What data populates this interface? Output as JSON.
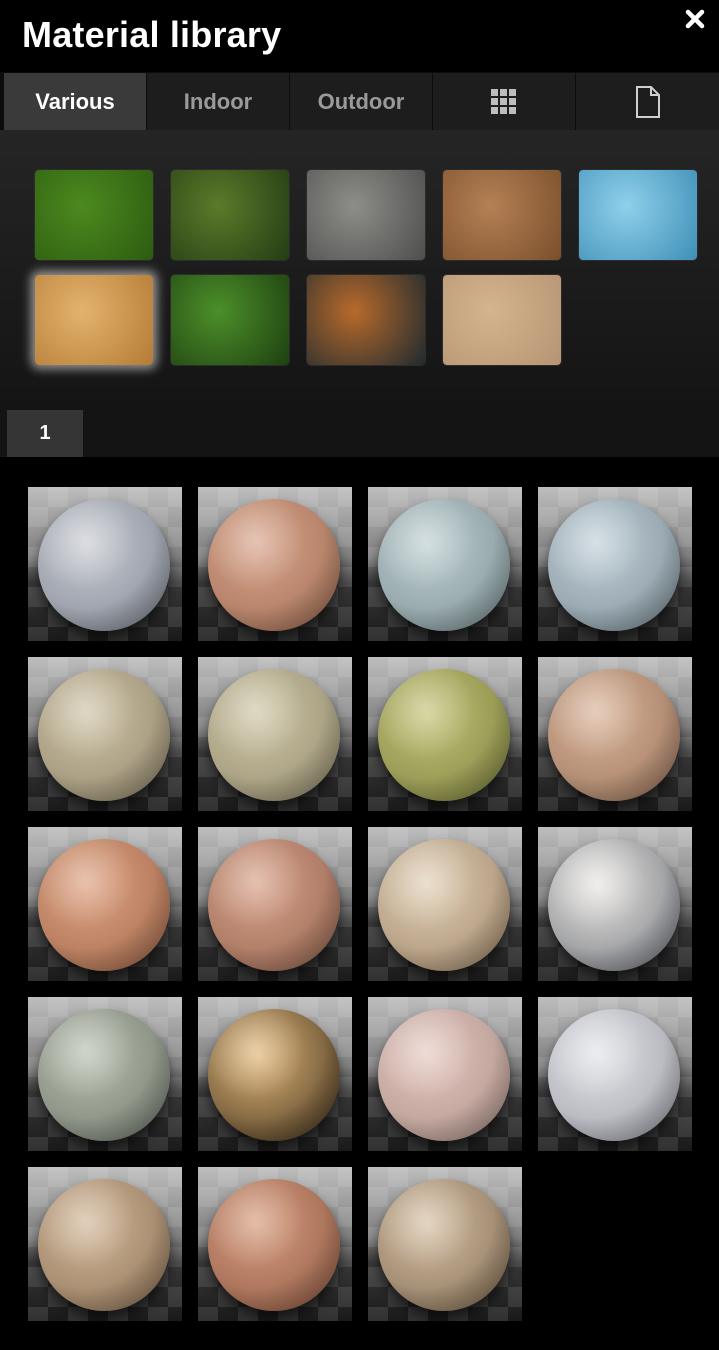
{
  "window": {
    "title": "Material library",
    "close_icon": "close-icon"
  },
  "tabs": [
    {
      "label": "Various",
      "active": true
    },
    {
      "label": "Indoor",
      "active": false
    },
    {
      "label": "Outdoor",
      "active": false
    },
    {
      "label": "",
      "icon": "grid-icon"
    },
    {
      "label": "",
      "icon": "document-icon"
    }
  ],
  "swatches": [
    {
      "name": "grass",
      "color1": "#4b8a1f",
      "color2": "#2e5b10",
      "selected": false
    },
    {
      "name": "leaves",
      "color1": "#5b7b2a",
      "color2": "#243c14",
      "selected": false
    },
    {
      "name": "stone-wall",
      "color1": "#8d8d8a",
      "color2": "#4e4e4c",
      "selected": false
    },
    {
      "name": "soil",
      "color1": "#b58054",
      "color2": "#7a4f2c",
      "selected": false
    },
    {
      "name": "water",
      "color1": "#8fd0ea",
      "color2": "#3e8fb8",
      "selected": false
    },
    {
      "name": "wood-rings",
      "color1": "#e3b36d",
      "color2": "#b47b36",
      "selected": true
    },
    {
      "name": "foliage",
      "color1": "#4c8f2a",
      "color2": "#1e4010",
      "selected": false
    },
    {
      "name": "abstract-metal",
      "color1": "#b86a2b",
      "color2": "#1f2a2f",
      "selected": false
    },
    {
      "name": "sand",
      "color1": "#d4b48e",
      "color2": "#b69473",
      "selected": false
    }
  ],
  "pages": [
    {
      "label": "1",
      "active": true
    }
  ],
  "materials": [
    {
      "name": "material-01",
      "color1": "#c9ccd3",
      "color2": "#7e8490"
    },
    {
      "name": "material-02",
      "color1": "#d9a68d",
      "color2": "#9e6b52"
    },
    {
      "name": "material-03",
      "color1": "#bfcfd2",
      "color2": "#7b8e92"
    },
    {
      "name": "material-04",
      "color1": "#c2d0d8",
      "color2": "#7c8d96"
    },
    {
      "name": "material-05",
      "color1": "#cfc4a8",
      "color2": "#8e8368"
    },
    {
      "name": "material-06",
      "color1": "#cfc7a8",
      "color2": "#90886a"
    },
    {
      "name": "material-07",
      "color1": "#c3c47a",
      "color2": "#7c7f3c"
    },
    {
      "name": "material-08",
      "color1": "#d9b49a",
      "color2": "#98735a"
    },
    {
      "name": "material-09",
      "color1": "#dea383",
      "color2": "#a06648"
    },
    {
      "name": "material-10",
      "color1": "#d7a18a",
      "color2": "#93644f"
    },
    {
      "name": "material-11",
      "color1": "#e0cfb5",
      "color2": "#9e8468"
    },
    {
      "name": "material-12",
      "color1": "#e8e6e2",
      "color2": "#6f727a"
    },
    {
      "name": "material-13",
      "color1": "#b9c0b0",
      "color2": "#6e766a"
    },
    {
      "name": "material-14",
      "color1": "#e1b77a",
      "color2": "#3b2c18"
    },
    {
      "name": "material-15",
      "color1": "#e6c9c2",
      "color2": "#a88e84"
    },
    {
      "name": "material-16",
      "color1": "#e3e4e8",
      "color2": "#9a9ca5"
    },
    {
      "name": "material-17",
      "color1": "#d2b89a",
      "color2": "#8b7054"
    },
    {
      "name": "material-18",
      "color1": "#d69c7e",
      "color2": "#8e5943"
    },
    {
      "name": "material-19",
      "color1": "#d6c0a4",
      "color2": "#7e6850"
    }
  ]
}
